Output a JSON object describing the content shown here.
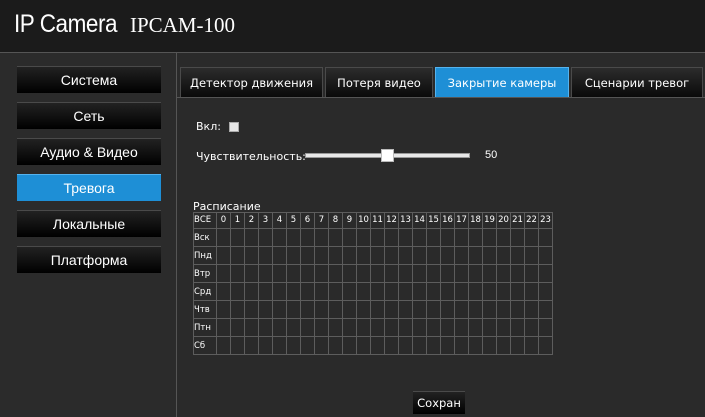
{
  "header": {
    "brand": "IP Camera",
    "model": "IPCAM-100"
  },
  "sidebar": {
    "active_index": 3,
    "items": [
      {
        "label": "Система"
      },
      {
        "label": "Сеть"
      },
      {
        "label": "Аудио & Видео"
      },
      {
        "label": "Тревога"
      },
      {
        "label": "Локальные"
      },
      {
        "label": "Платформа"
      }
    ]
  },
  "tabs": {
    "active_index": 2,
    "items": [
      {
        "label": "Детектор движения"
      },
      {
        "label": "Потеря видео"
      },
      {
        "label": "Закрытие камеры"
      },
      {
        "label": "Сценарии тревог"
      }
    ]
  },
  "form": {
    "enable_label": "Вкл:",
    "enable_checked": false,
    "sensitivity_label": "Чувствительность:",
    "sensitivity_value": "50",
    "sensitivity_fraction": 0.5
  },
  "schedule": {
    "title": "Расписание",
    "all_label": "ВСЕ",
    "hours": [
      "0",
      "1",
      "2",
      "3",
      "4",
      "5",
      "6",
      "7",
      "8",
      "9",
      "10",
      "11",
      "12",
      "13",
      "14",
      "15",
      "16",
      "17",
      "18",
      "19",
      "20",
      "21",
      "22",
      "23"
    ],
    "days": [
      "Вск",
      "Пнд",
      "Втр",
      "Срд",
      "Чтв",
      "Птн",
      "Сб"
    ]
  },
  "actions": {
    "save_label": "Сохран"
  },
  "colors": {
    "accent": "#1e8fd6",
    "background": "#2a2a2a",
    "header": "#1b1b1b"
  }
}
